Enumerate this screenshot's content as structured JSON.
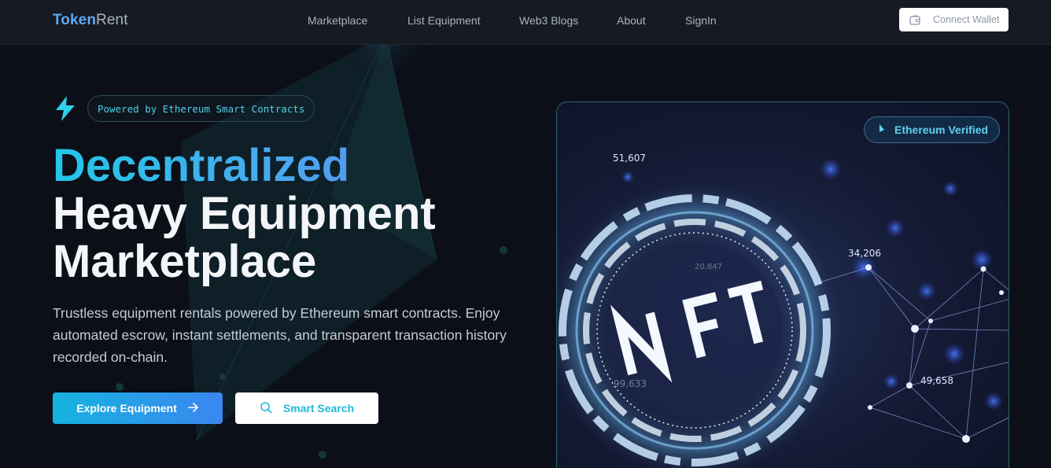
{
  "navbar": {
    "brand_part1": "Token",
    "brand_part2": "Rent",
    "links": [
      "Marketplace",
      "List Equipment",
      "Web3 Blogs",
      "About",
      "SignIn"
    ],
    "connect_label": "Connect Wallet",
    "connect_icon": "wallet-icon"
  },
  "hero": {
    "badge_icon": "bolt-icon",
    "badge_text": "Powered by Ethereum Smart Contracts",
    "headline_line1": "Decentralized",
    "headline_line2": "Heavy Equipment",
    "headline_line3": "Marketplace",
    "description": "Trustless equipment rentals powered by Ethereum smart contracts. Enjoy automated escrow, instant settlements, and transparent transaction history recorded on-chain.",
    "explore_label": "Explore Equipment",
    "explore_icon": "arrow-right-icon",
    "search_label": "Smart Search",
    "search_icon": "search-icon"
  },
  "card": {
    "verified_label": "Ethereum Verified",
    "verified_icon": "ethereum-icon",
    "image_text": "NFT",
    "image_numbers": [
      "51,607",
      "34,206",
      "49,658",
      "99,633",
      "20,847"
    ]
  },
  "colors": {
    "background": "#0c0f17",
    "accent_cyan": "#22c7e8",
    "accent_blue": "#3b86f0",
    "navbar": "#161a22"
  }
}
